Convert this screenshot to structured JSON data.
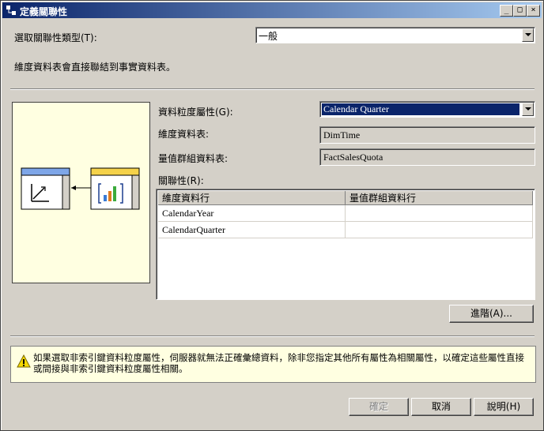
{
  "window": {
    "title": "定義關聯性",
    "min_glyph": "_",
    "max_glyph": "□",
    "close_glyph": "×"
  },
  "relationship_type": {
    "label": "選取關聯性類型(T):",
    "value": "一般"
  },
  "description": "維度資料表會直接聯結到事實資料表。",
  "granularity": {
    "label": "資料粒度屬性(G):",
    "value": "Calendar Quarter"
  },
  "dimension_table": {
    "label": "維度資料表:",
    "value": "DimTime"
  },
  "measure_group_table": {
    "label": "量值群組資料表:",
    "value": "FactSalesQuota"
  },
  "relationship_grid": {
    "label": "關聯性(R):",
    "columns": [
      "維度資料行",
      "量值群組資料行"
    ],
    "rows": [
      {
        "dimension_column": "CalendarYear",
        "measure_column": ""
      },
      {
        "dimension_column": "CalendarQuarter",
        "measure_column": ""
      }
    ]
  },
  "advanced_button": "進階(A)...",
  "warning_text": "如果選取非索引鍵資料粒度屬性，伺服器就無法正確彙總資料，除非您指定其他所有屬性為相關屬性，以確定這些屬性直接或間接與非索引鍵資料粒度屬性相關。",
  "buttons": {
    "ok": "確定",
    "cancel": "取消",
    "help": "說明(H)"
  },
  "colors": {
    "title_start": "#0a246a",
    "title_end": "#a6caf0",
    "selection": "#0a246a",
    "info_bg": "#ffffe1",
    "dim_header": "#7ea6e8",
    "fact_header": "#f5d24a"
  }
}
